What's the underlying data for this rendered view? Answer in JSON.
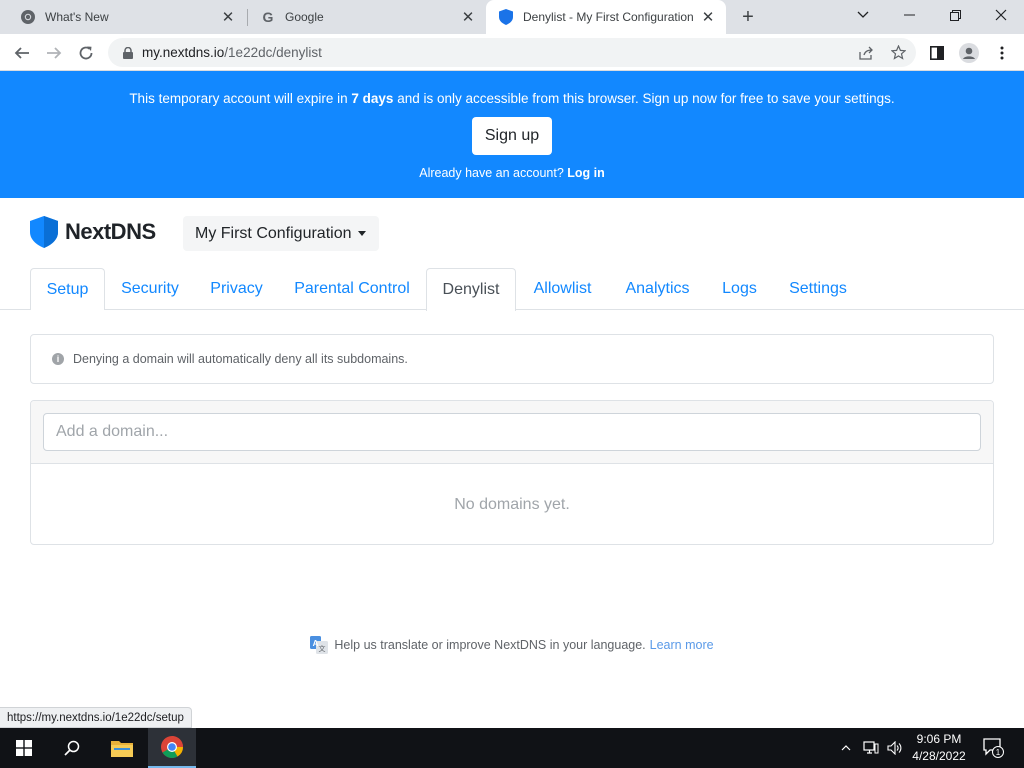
{
  "browser": {
    "tabs": [
      {
        "title": "What's New",
        "icon": "chrome-icon"
      },
      {
        "title": "Google",
        "icon": "google-icon"
      },
      {
        "title": "Denylist - My First Configuration",
        "icon": "nextdns-shield-icon",
        "active": true
      }
    ],
    "url_host": "my.nextdns.io",
    "url_path": "/1e22dc/denylist",
    "status_url": "https://my.nextdns.io/1e22dc/setup"
  },
  "banner": {
    "message_before": "This temporary account will expire in ",
    "message_bold": "7 days",
    "message_after": " and is only accessible from this browser. Sign up now for free to save your settings.",
    "signup_label": "Sign up",
    "login_prompt": "Already have an account? ",
    "login_link": "Log in",
    "background": "#1288ff"
  },
  "header": {
    "brand": "NextDNS",
    "configuration": "My First Configuration"
  },
  "nav": {
    "tabs": [
      "Setup",
      "Security",
      "Privacy",
      "Parental Control",
      "Denylist",
      "Allowlist",
      "Analytics",
      "Logs",
      "Settings"
    ],
    "active": "Denylist",
    "link_color": "#1288ff"
  },
  "denylist": {
    "info": "Denying a domain will automatically deny all its subdomains.",
    "input_placeholder": "Add a domain...",
    "empty_message": "No domains yet."
  },
  "footer": {
    "translate_text": "Help us translate or improve NextDNS in your language.",
    "learn_more": "Learn more"
  },
  "taskbar": {
    "time": "9:06 PM",
    "date": "4/28/2022",
    "notification_count": "1"
  }
}
